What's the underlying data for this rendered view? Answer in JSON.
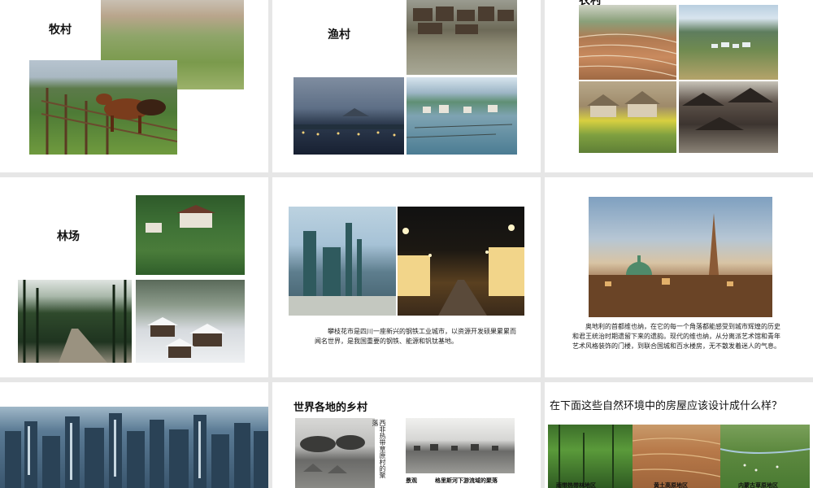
{
  "slides": {
    "pasture": {
      "title": "牧村"
    },
    "fishing": {
      "title": "渔村"
    },
    "farm": {
      "title": "农村"
    },
    "forest": {
      "title": "林场"
    },
    "steel": {
      "caption": "攀枝花市是四川一座新兴的钢铁工业城市，以资源开发硕果累累而闻名世界，是我国重要的钢铁、能源和钒钛基地。"
    },
    "vienna": {
      "caption": "奥地利的首都维也纳，在它的每一个角落都能感受到城市辉煌的历史和君王统治时期遗留下来的遗韵。现代的维也纳，从分离派艺术馆和青年艺术风格装饰的门楼，到联合国城和百水楼房，无不散发着迷人的气息。"
    },
    "world": {
      "title": "世界各地的乡村",
      "caption_vertical": "西非热带草原村的聚落",
      "caption_left": "景观",
      "caption_bottom": "格里斯河下游流域的聚落"
    },
    "question": {
      "title": "在下面这些自然环境中的房屋应该设计成什么样？",
      "labels": [
        "雨带热带林地区",
        "黄土高原地区",
        "内蒙古草原地区"
      ]
    }
  }
}
